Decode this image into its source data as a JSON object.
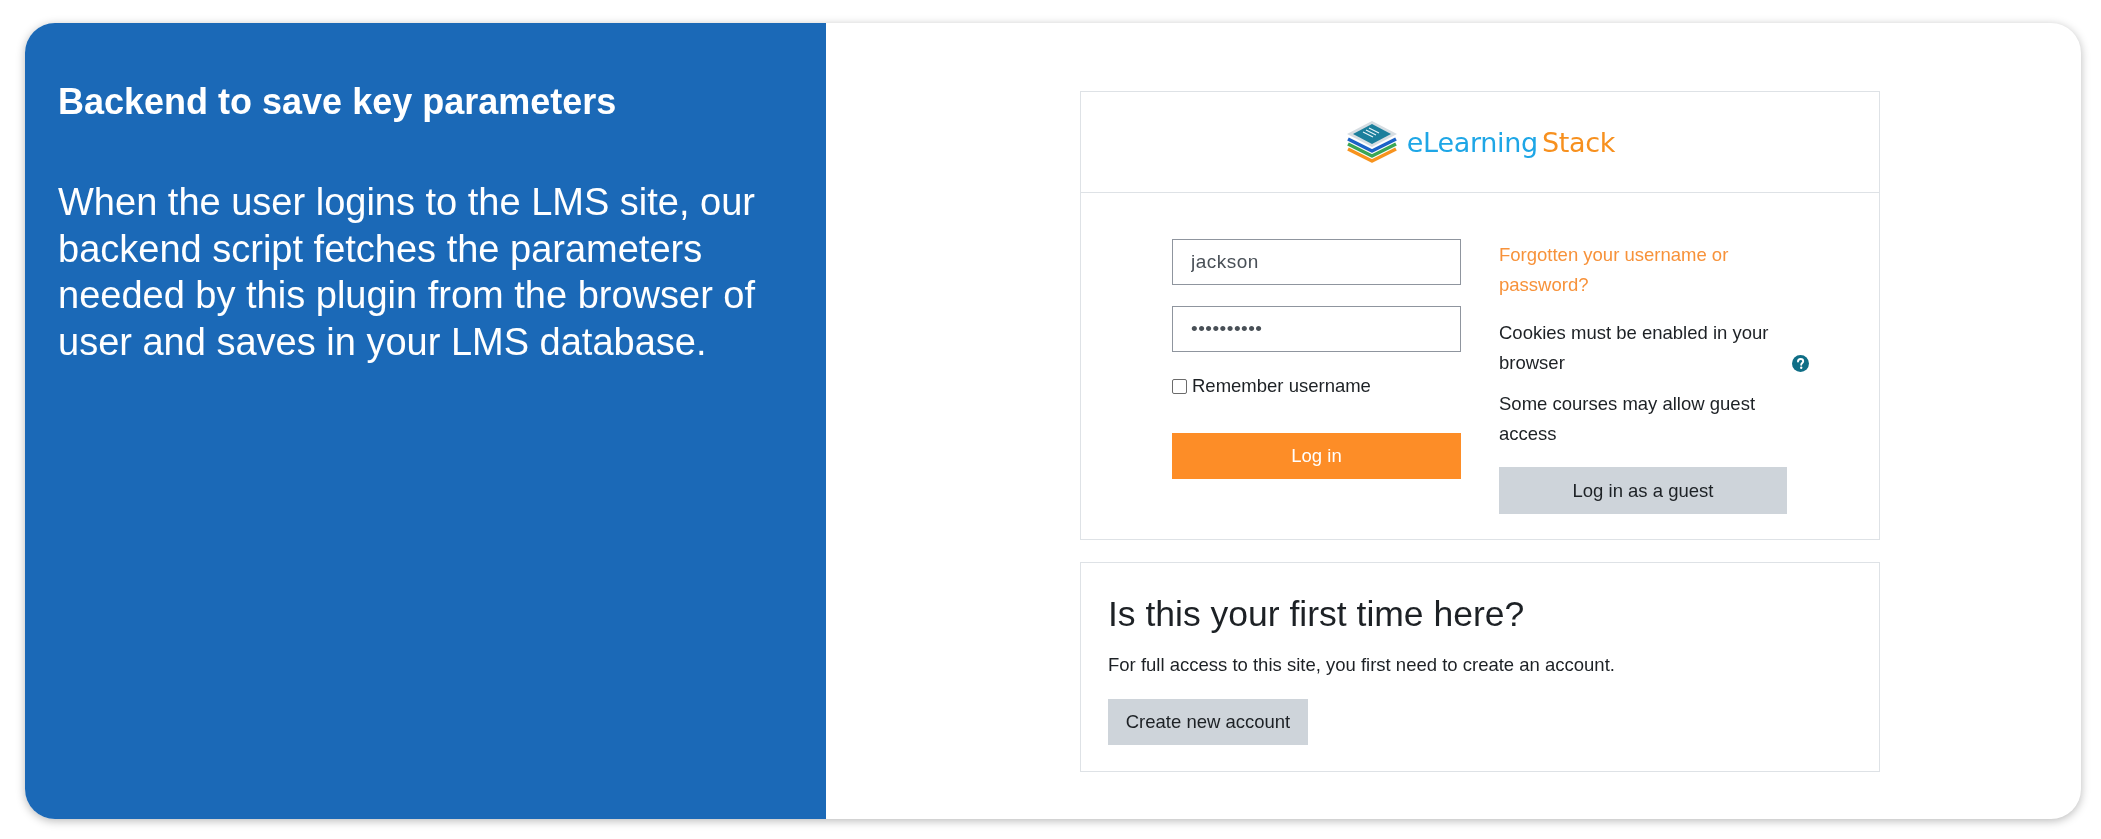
{
  "info_panel": {
    "title": "Backend to save key parameters",
    "description": "When the user logins to the LMS site, our backend script fetches the parameters needed by this plugin from the browser of user and saves in your LMS database."
  },
  "login_card": {
    "logo": {
      "primary": "eLearning",
      "accent": "Stack"
    },
    "username": {
      "value": "jackson"
    },
    "password": {
      "value": "••••••••••"
    },
    "remember": {
      "label": "Remember username",
      "checked": false
    },
    "login_button": "Log in",
    "forgot_link": "Forgotten your username or password?",
    "cookies_note": "Cookies must be enabled in your browser",
    "guest_note": "Some courses may allow guest access",
    "guest_button": "Log in as a guest"
  },
  "signup_card": {
    "title": "Is this your first time here?",
    "text": "For full access to this site, you first need to create an account.",
    "button": "Create new account"
  }
}
